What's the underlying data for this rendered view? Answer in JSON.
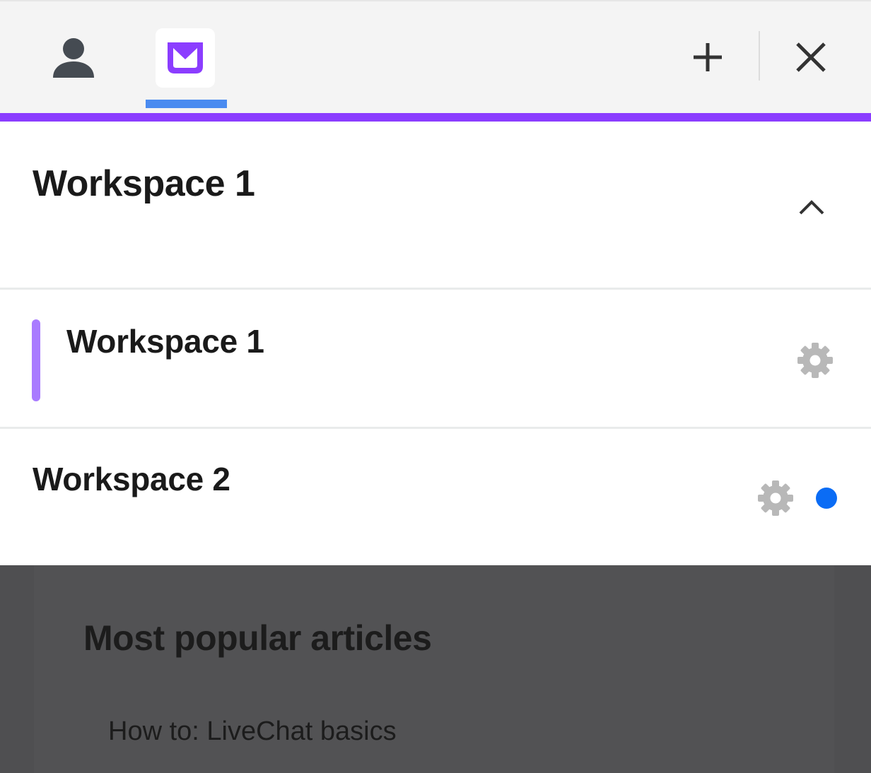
{
  "topbar": {
    "tabs": [
      {
        "icon": "person-icon",
        "active": false
      },
      {
        "icon": "livechat-app-icon",
        "active": true
      }
    ],
    "actions": [
      {
        "icon": "plus-icon"
      },
      {
        "icon": "close-icon"
      }
    ],
    "accent_color": "#8b3dff",
    "indicator_color": "#4a8bf0"
  },
  "workspace_header": {
    "title": "Workspace 1",
    "toggle_icon": "chevron-up-icon"
  },
  "workspaces": [
    {
      "name": "Workspace 1",
      "selected": true,
      "settings_icon": "gear-icon",
      "indicator_color": "#a97bff"
    },
    {
      "name": "Workspace 2",
      "selected": false,
      "settings_icon": "gear-icon",
      "unread": true,
      "unread_color": "#0a6cf5"
    }
  ],
  "background": {
    "section_title": "Most popular articles",
    "articles": [
      "How to: LiveChat basics"
    ]
  }
}
